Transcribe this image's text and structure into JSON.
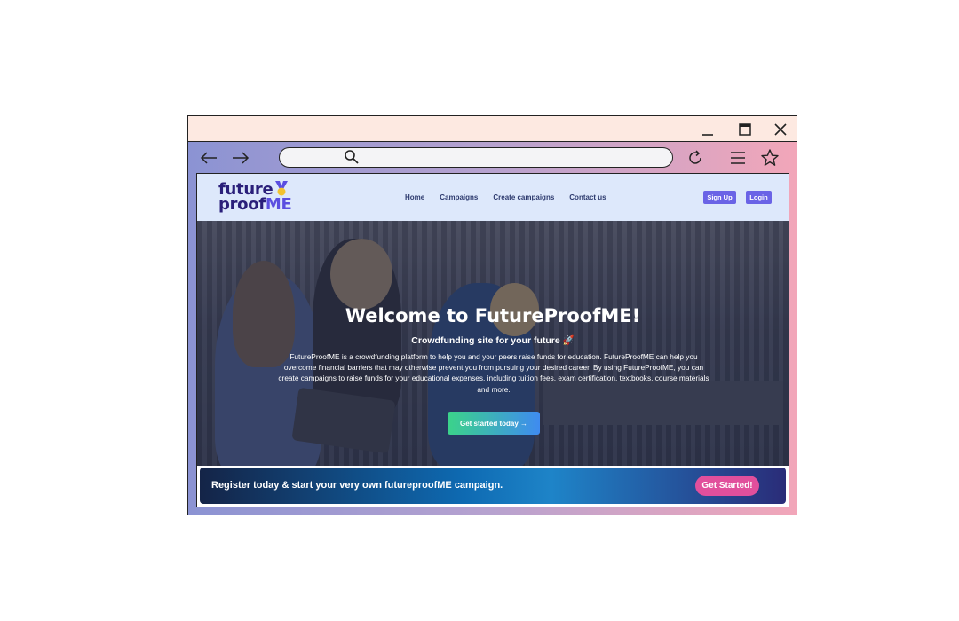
{
  "browser": {
    "url_value": "",
    "icons": {
      "minimize": "minimize-icon",
      "maximize": "maximize-icon",
      "close": "close-icon",
      "back": "arrow-left-icon",
      "forward": "arrow-right-icon",
      "search": "search-icon",
      "reload": "reload-icon",
      "menu": "hamburger-menu-icon",
      "bookmark": "star-icon"
    }
  },
  "site": {
    "logo": {
      "line1": "future",
      "line2_a": "proof",
      "line2_b": "ME"
    },
    "nav": [
      "Home",
      "Campaigns",
      "Create campaigns",
      "Contact us"
    ],
    "signup_label": "Sign Up",
    "login_label": "Login"
  },
  "hero": {
    "title": "Welcome to FutureProofME!",
    "subtitle": "Crowdfunding site for your future 🚀",
    "description": "FutureProofME is a crowdfunding platform to help you and your peers raise funds for education. FutureProofME can help you overcome financial barriers that may otherwise prevent you from pursuing your desired career. By using FutureProofME, you can create campaigns to raise funds for your educational expenses, including tuition fees, exam certification, textbooks, course materials and more.",
    "cta_label": "Get started today →"
  },
  "banner": {
    "message": "Register today & start your very own futureproofME campaign.",
    "button_label": "Get Started!"
  },
  "colors": {
    "nav_bg": "#dde8fb",
    "brand": "#2a1f7a",
    "button": "#6a63e6",
    "cta_pink": "#e14f9c"
  }
}
